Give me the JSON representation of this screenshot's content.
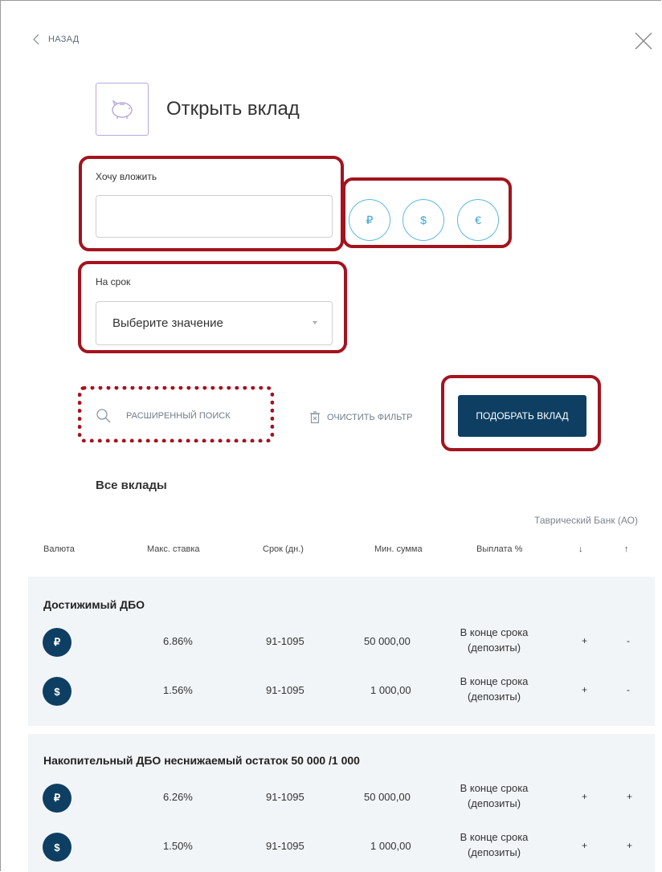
{
  "nav": {
    "back_label": "НАЗАД"
  },
  "header": {
    "title": "Открыть вклад",
    "icon": "piggy-bank-icon"
  },
  "form": {
    "amount": {
      "label": "Хочу вложить",
      "value": "",
      "placeholder": ""
    },
    "currencies": [
      "₽",
      "$",
      "€"
    ],
    "term": {
      "label": "На срок",
      "value": "Выберите значение"
    },
    "advanced_search_label": "РАСШИРЕННЫЙ ПОИСК",
    "clear_filter_label": "ОЧИСТИТЬ ФИЛЬТР",
    "submit_label": "ПОДОБРАТЬ ВКЛАД"
  },
  "results": {
    "title": "Все вклады",
    "bank_name": "Таврический Банк (АО)",
    "columns": [
      "Валюта",
      "Макс. ставка",
      "Срок (дн.)",
      "Мин. сумма",
      "Выплата %",
      "↓",
      "↑"
    ],
    "groups": [
      {
        "name": "Достижимый ДБО",
        "rows": [
          {
            "currency": "₽",
            "rate": "6.86%",
            "term": "91-1095",
            "min_sum": "50 000,00",
            "payout_line1": "В конце срока",
            "payout_line2": "(депозиты)",
            "down": "+",
            "up": "-"
          },
          {
            "currency": "$",
            "rate": "1.56%",
            "term": "91-1095",
            "min_sum": "1 000,00",
            "payout_line1": "В конце срока",
            "payout_line2": "(депозиты)",
            "down": "+",
            "up": "-"
          }
        ]
      },
      {
        "name": "Накопительный ДБО неснижаемый остаток 50 000 /1 000",
        "rows": [
          {
            "currency": "₽",
            "rate": "6.26%",
            "term": "91-1095",
            "min_sum": "50 000,00",
            "payout_line1": "В конце срока",
            "payout_line2": "(депозиты)",
            "down": "+",
            "up": "+"
          },
          {
            "currency": "$",
            "rate": "1.50%",
            "term": "91-1095",
            "min_sum": "1 000,00",
            "payout_line1": "В конце срока",
            "payout_line2": "(депозиты)",
            "down": "+",
            "up": "+"
          }
        ]
      }
    ]
  },
  "colors": {
    "primary": "#0e3f63",
    "accent": "#5fb9df",
    "highlight": "#a4131e"
  }
}
